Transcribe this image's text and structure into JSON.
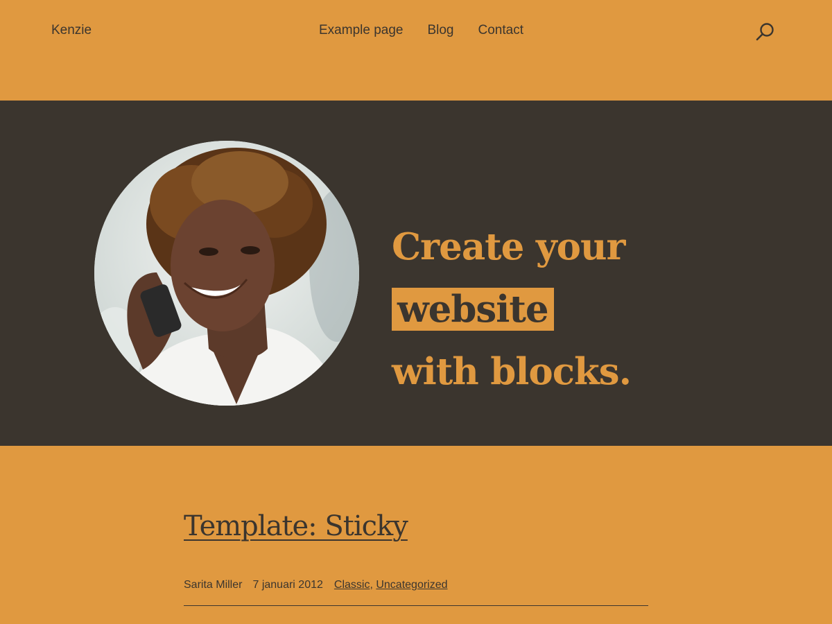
{
  "header": {
    "site_title": "Kenzie",
    "nav": [
      "Example page",
      "Blog",
      "Contact"
    ],
    "search_icon": "search-icon"
  },
  "hero": {
    "headline_before": "Create your",
    "headline_highlight": "website",
    "headline_after": "with blocks.",
    "image": "portrait-woman-on-phone"
  },
  "post": {
    "title": "Template: Sticky",
    "author": "Sarita Miller",
    "date": "7 januari 2012",
    "categories": [
      "Classic",
      "Uncategorized"
    ]
  },
  "colors": {
    "accent": "#e09940",
    "dark": "#3b352e"
  }
}
